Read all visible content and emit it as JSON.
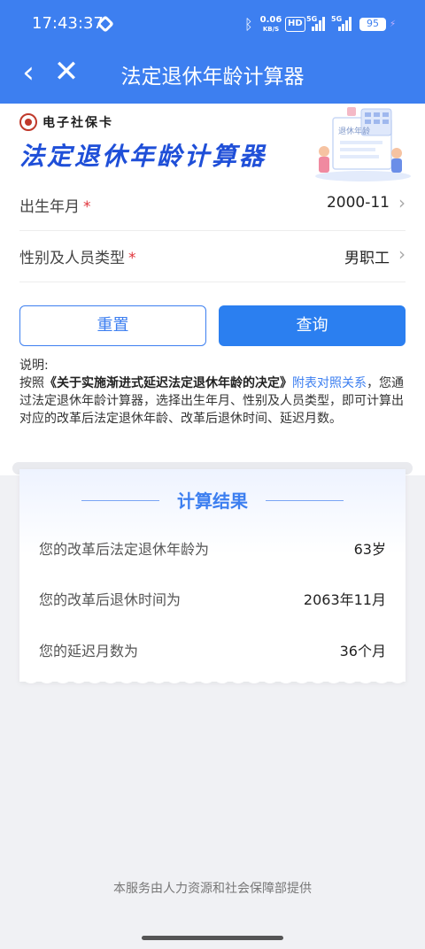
{
  "status_bar": {
    "time": "17:43:37",
    "net_speed_top": "0.06",
    "net_speed_bottom": "KB/S",
    "hd": "HD",
    "sig1_label": "5G",
    "sig2_label": "5G",
    "battery": "95"
  },
  "nav": {
    "back_icon": "‹",
    "close_icon": "✕",
    "title": "法定退休年龄计算器"
  },
  "brand": {
    "name": "电子社保卡",
    "hero_title": "法定退休年龄计算器",
    "illustration_text": "退休年龄"
  },
  "form": {
    "birth_label": "出生年月",
    "birth_value": "2000-11",
    "type_label": "性别及人员类型",
    "type_value": "男职工",
    "required_mark": "*"
  },
  "buttons": {
    "reset": "重置",
    "query": "查询"
  },
  "note": {
    "title": "说明:",
    "prefix": "按照",
    "bold": "《关于实施渐进式延迟法定退休年龄的决定》",
    "link": "附表对照关系",
    "suffix": "，您通过法定退休年龄计算器，选择出生年月、性别及人员类型，即可计算出对应的改革后法定退休年龄、改革后退休时间、延迟月数。"
  },
  "result": {
    "title": "计算结果",
    "rows": [
      {
        "label": "您的改革后法定退休年龄为",
        "value": "63岁"
      },
      {
        "label": "您的改革后退休时间为",
        "value": "2063年11月"
      },
      {
        "label": "您的延迟月数为",
        "value": "36个月"
      }
    ]
  },
  "footer": {
    "text": "本服务由人力资源和社会保障部提供"
  },
  "colors": {
    "primary": "#3d7ff0",
    "required": "#e0333a",
    "hero_title": "#1f4fd8"
  }
}
